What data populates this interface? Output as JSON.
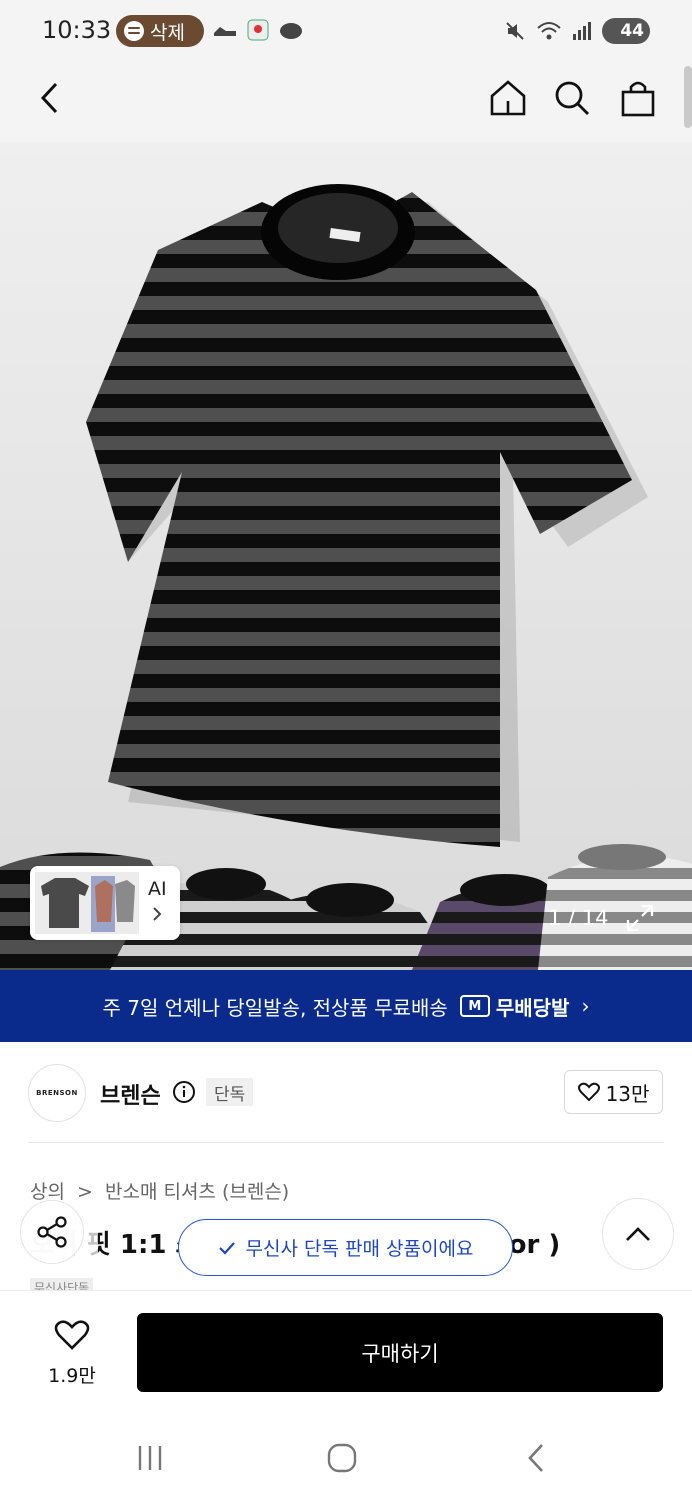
{
  "status_bar": {
    "time": "10:33",
    "pill_label": "삭제",
    "battery": "44"
  },
  "colors": {
    "banner_bg": "#0a2a8c",
    "toast_accent": "#1e46c4",
    "buy_button_bg": "#000000"
  },
  "hero": {
    "counter": "1 / 14",
    "ai_label": "AI"
  },
  "banner": {
    "text": "주 7일 언제나 당일발송, 전상품 무료배송",
    "badge_letter": "M",
    "badge_label": "무배당발",
    "chevron": "›"
  },
  "brand": {
    "logo_text": "BRENSON",
    "name": "브렌슨",
    "exclusive_tag": "단독",
    "likes": "13만"
  },
  "product": {
    "breadcrumb_1": "상의",
    "breadcrumb_sep": ">",
    "breadcrumb_2": "반소매 티셔츠 (브렌슨)",
    "title": "오버 핏 1:1 스트라이프 반팔 티셔츠 ( Color )",
    "tag": "무신사단독"
  },
  "toast": {
    "text": "무신사 단독 판매 상품이에요"
  },
  "bottom": {
    "wish_count": "1.9만",
    "buy_label": "구매하기"
  },
  "icons": [
    "back-icon",
    "home-icon",
    "search-icon",
    "bag-icon",
    "share-icon",
    "heart-icon",
    "info-icon",
    "expand-icon",
    "chevron-up-icon",
    "check-icon"
  ]
}
